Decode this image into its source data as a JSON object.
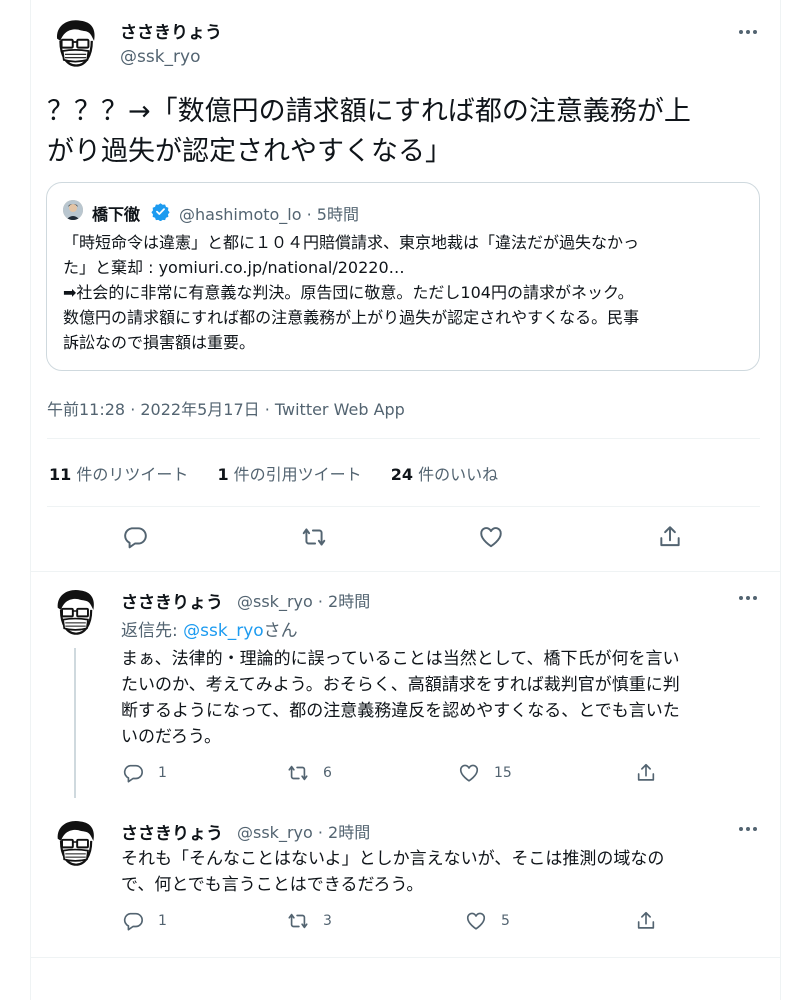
{
  "main_tweet": {
    "author_name": "ささきりょう",
    "author_handle": "@ssk_ryo",
    "text_line1": "？？？→「数億円の請求額にすれば都の注意義務が上",
    "text_line2": "がり過失が認定されやすくなる」",
    "quote": {
      "author_name": "橋下徹",
      "meta": "@hashimoto_lo · 5時間",
      "lines": [
        "「時短命令は違憲」と都に１０４円賠償請求、東京地裁は「違法だが過失なかっ",
        "た」と棄却 : yomiuri.co.jp/national/20220…",
        "➡社会的に非常に有意義な判決。原告団に敬意。ただし104円の請求がネック。",
        "数億円の請求額にすれば都の注意義務が上がり過失が認定されやすくなる。民事",
        "訴訟なので損害額は重要。"
      ]
    },
    "timestamp": "午前11:28 · 2022年5月17日 · Twitter Web App",
    "stats": {
      "retweets_num": "11",
      "retweets_label": " 件のリツイート",
      "quotes_num": "1",
      "quotes_label": " 件の引用ツイート",
      "likes_num": "24",
      "likes_label": " 件のいいね"
    }
  },
  "replies": [
    {
      "author_name": "ささきりょう",
      "handle_time": "@ssk_ryo · 2時間",
      "reply_to_prefix": "返信先: ",
      "reply_to_handle": "@ssk_ryo",
      "reply_to_suffix": "さん",
      "lines": [
        "まぁ、法律的・理論的に誤っていることは当然として、橋下氏が何を言い",
        "たいのか、考えてみよう。おそらく、高額請求をすれば裁判官が慎重に判",
        "断するようになって、都の注意義務違反を認めやすくなる、とでも言いた",
        "いのだろう。"
      ],
      "reply_count": "1",
      "retweet_count": "6",
      "like_count": "15"
    },
    {
      "author_name": "ささきりょう",
      "handle_time": "@ssk_ryo · 2時間",
      "lines": [
        "それも「そんなことはないよ」としか言えないが、そこは推測の域なの",
        "で、何とでも言うことはできるだろう。"
      ],
      "reply_count": "1",
      "retweet_count": "3",
      "like_count": "5"
    }
  ],
  "icons": {
    "more": "more-icon",
    "reply": "reply-icon",
    "retweet": "retweet-icon",
    "like": "heart-icon",
    "share": "share-icon",
    "verified": "verified-badge-icon"
  },
  "colors": {
    "accent": "#1d9bf0",
    "text": "#0f1419",
    "secondary": "#536471",
    "border": "#cfd9de"
  }
}
